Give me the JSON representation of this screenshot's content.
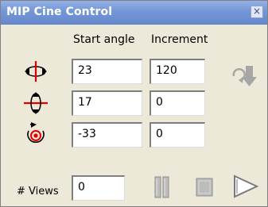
{
  "window": {
    "title": "MIP Cine Control",
    "close_glyph": "×"
  },
  "headers": {
    "start_angle": "Start angle",
    "increment": "Increment"
  },
  "rows": [
    {
      "axis_icon": "rotate-horizontal-axis-icon",
      "start": "23",
      "increment": "120"
    },
    {
      "axis_icon": "rotate-vertical-axis-icon",
      "start": "17",
      "increment": "0"
    },
    {
      "axis_icon": "rotate-depth-axis-icon",
      "start": "-33",
      "increment": "0"
    }
  ],
  "views": {
    "label": "# Views",
    "value": "0"
  },
  "icons": {
    "apply": "rotate-apply-icon",
    "pause": "pause-icon",
    "stop": "stop-icon",
    "play": "play-icon"
  }
}
